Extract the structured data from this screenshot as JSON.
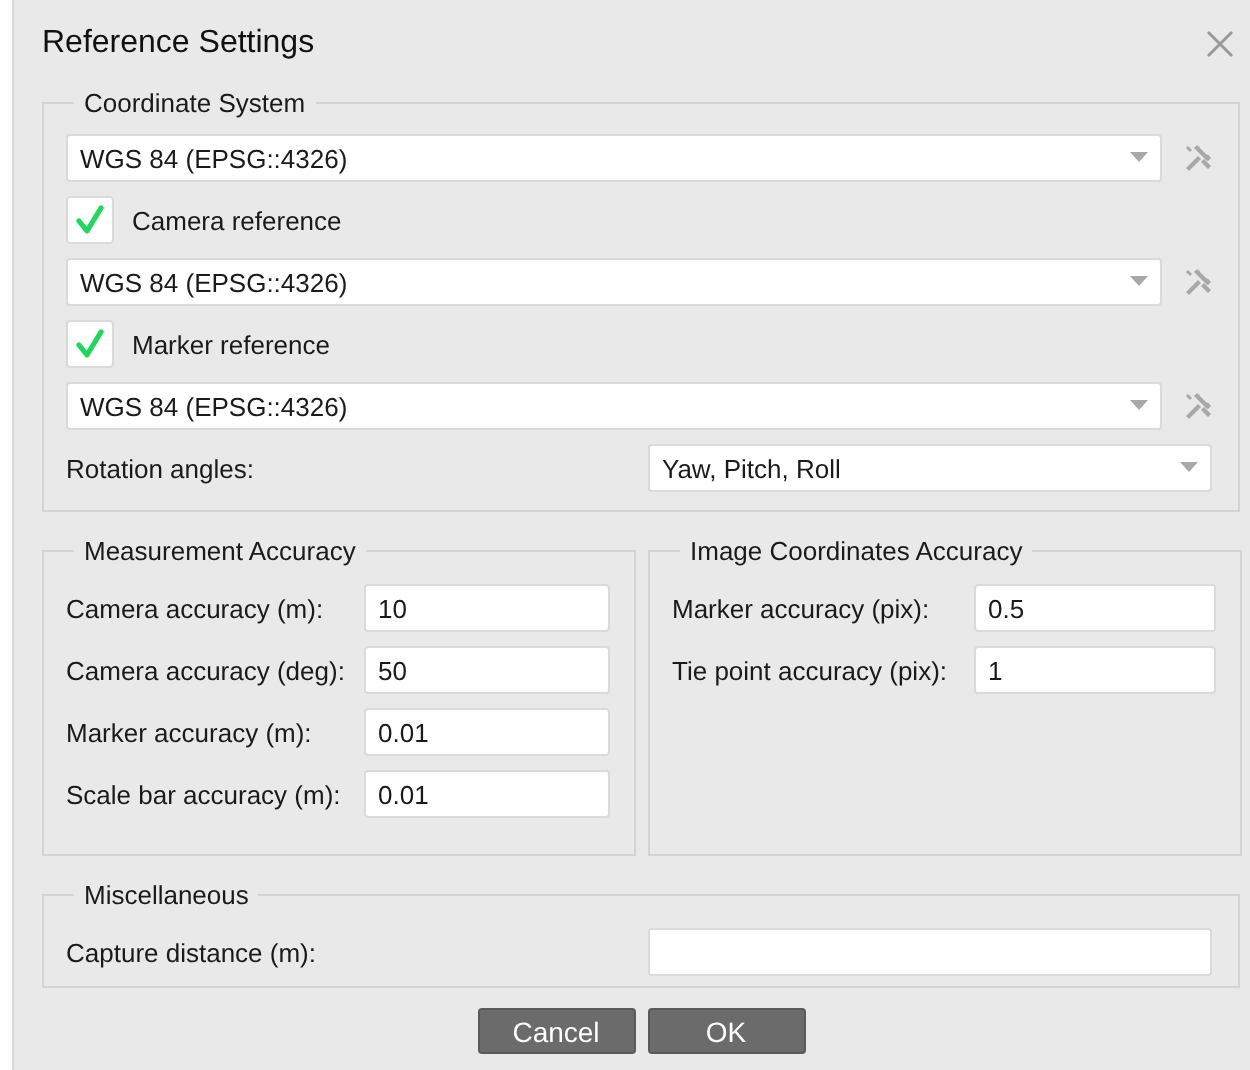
{
  "window": {
    "title": "Reference Settings"
  },
  "coordinate_system": {
    "title": "Coordinate System",
    "rows": [
      {
        "kind": "combo",
        "value": "WGS 84 (EPSG::4326)"
      },
      {
        "kind": "checkbox",
        "label": "Camera reference",
        "checked": true
      },
      {
        "kind": "combo",
        "value": "WGS 84 (EPSG::4326)"
      },
      {
        "kind": "checkbox",
        "label": "Marker reference",
        "checked": true
      },
      {
        "kind": "combo",
        "value": "WGS 84 (EPSG::4326)"
      },
      {
        "kind": "labeled_combo",
        "label": "Rotation angles:",
        "value": "Yaw, Pitch, Roll"
      }
    ]
  },
  "measurement_accuracy": {
    "title": "Measurement Accuracy",
    "fields": [
      {
        "label": "Camera accuracy (m):",
        "value": "10"
      },
      {
        "label": "Camera accuracy (deg):",
        "value": "50"
      },
      {
        "label": "Marker accuracy (m):",
        "value": "0.01"
      },
      {
        "label": "Scale bar accuracy (m):",
        "value": "0.01"
      }
    ]
  },
  "image_coordinates_accuracy": {
    "title": "Image Coordinates Accuracy",
    "fields": [
      {
        "label": "Marker accuracy (pix):",
        "value": "0.5"
      },
      {
        "label": "Tie point accuracy (pix):",
        "value": "1"
      }
    ]
  },
  "miscellaneous": {
    "title": "Miscellaneous",
    "fields": [
      {
        "label": "Capture distance (m):"
      }
    ]
  },
  "buttons": [
    "Cancel",
    "OK"
  ]
}
